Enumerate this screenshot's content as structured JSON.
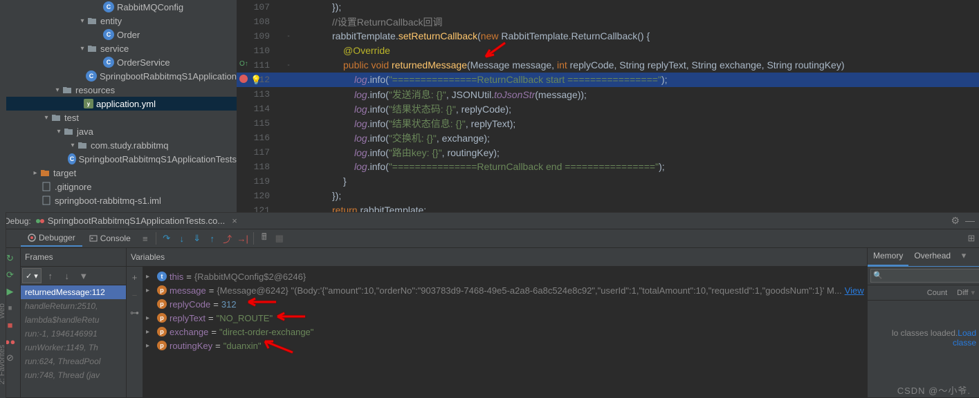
{
  "project": {
    "items": [
      {
        "label": "RabbitMQConfig",
        "indent": 128,
        "icon": "class",
        "arrow": ""
      },
      {
        "label": "entity",
        "indent": 104,
        "icon": "folder",
        "arrow": "▾"
      },
      {
        "label": "Order",
        "indent": 128,
        "icon": "class",
        "arrow": ""
      },
      {
        "label": "service",
        "indent": 104,
        "icon": "folder",
        "arrow": "▾"
      },
      {
        "label": "OrderService",
        "indent": 128,
        "icon": "class",
        "arrow": ""
      },
      {
        "label": "SpringbootRabbitmqS1Application",
        "indent": 104,
        "icon": "class-run",
        "arrow": ""
      },
      {
        "label": "resources",
        "indent": 68,
        "icon": "res-folder",
        "arrow": "▾"
      },
      {
        "label": "application.yml",
        "indent": 100,
        "icon": "yml",
        "arrow": "",
        "selected": true
      },
      {
        "label": "test",
        "indent": 52,
        "icon": "folder",
        "arrow": "▾"
      },
      {
        "label": "java",
        "indent": 70,
        "icon": "folder",
        "arrow": "▾"
      },
      {
        "label": "com.study.rabbitmq",
        "indent": 90,
        "icon": "folder",
        "arrow": "▾"
      },
      {
        "label": "SpringbootRabbitmqS1ApplicationTests",
        "indent": 114,
        "icon": "class-run",
        "arrow": ""
      },
      {
        "label": "target",
        "indent": 36,
        "icon": "target",
        "arrow": "▸"
      },
      {
        "label": ".gitignore",
        "indent": 38,
        "icon": "file",
        "arrow": ""
      },
      {
        "label": "springboot-rabbitmq-s1.iml",
        "indent": 38,
        "icon": "file",
        "arrow": ""
      }
    ]
  },
  "editor": {
    "lines": [
      {
        "no": 107,
        "segments": [
          {
            "ind": 36
          },
          {
            "t": "});",
            "k": "pl"
          }
        ]
      },
      {
        "no": 108,
        "segments": [
          {
            "ind": 36
          },
          {
            "t": "//设置ReturnCallback回调",
            "k": "cm"
          }
        ]
      },
      {
        "no": 109,
        "fold": "-",
        "segments": [
          {
            "ind": 36
          },
          {
            "t": "rabbitTemplate.",
            "k": "pl"
          },
          {
            "t": "setReturnCallback",
            "k": "fn"
          },
          {
            "t": "(",
            "k": "pl"
          },
          {
            "t": "new ",
            "k": "kw"
          },
          {
            "t": "RabbitTemplate.ReturnCallback() {",
            "k": "pl"
          }
        ]
      },
      {
        "no": 110,
        "segments": [
          {
            "ind": 52
          },
          {
            "t": "@Override",
            "k": "an"
          }
        ]
      },
      {
        "no": 111,
        "gutter": "override",
        "fold": "-",
        "segments": [
          {
            "ind": 52
          },
          {
            "t": "public void ",
            "k": "kw"
          },
          {
            "t": "returnedMessage",
            "k": "fn"
          },
          {
            "t": "(Message message, ",
            "k": "pl"
          },
          {
            "t": "int ",
            "k": "kw"
          },
          {
            "t": "replyCode, String replyText, String exchange, String routingKey)",
            "k": "pl"
          }
        ]
      },
      {
        "no": 112,
        "bp": true,
        "hl": true,
        "segments": [
          {
            "ind": 68
          },
          {
            "t": "log",
            "k": "vr"
          },
          {
            "t": ".info(",
            "k": "plh"
          },
          {
            "t": "\"===============ReturnCallback start ================\"",
            "k": "strH"
          },
          {
            "t": ");",
            "k": "plh"
          }
        ]
      },
      {
        "no": 113,
        "segments": [
          {
            "ind": 68
          },
          {
            "t": "log",
            "k": "vr"
          },
          {
            "t": ".info(",
            "k": "pl"
          },
          {
            "t": "\"发送消息: {}\"",
            "k": "str"
          },
          {
            "t": ", JSONUtil.",
            "k": "pl"
          },
          {
            "t": "toJsonStr",
            "k": "vr"
          },
          {
            "t": "(message));",
            "k": "pl"
          }
        ]
      },
      {
        "no": 114,
        "segments": [
          {
            "ind": 68
          },
          {
            "t": "log",
            "k": "vr"
          },
          {
            "t": ".info(",
            "k": "pl"
          },
          {
            "t": "\"结果状态码: {}\"",
            "k": "str"
          },
          {
            "t": ", replyCode);",
            "k": "pl"
          }
        ]
      },
      {
        "no": 115,
        "segments": [
          {
            "ind": 68
          },
          {
            "t": "log",
            "k": "vr"
          },
          {
            "t": ".info(",
            "k": "pl"
          },
          {
            "t": "\"结果状态信息: {}\"",
            "k": "str"
          },
          {
            "t": ", replyText);",
            "k": "pl"
          }
        ]
      },
      {
        "no": 116,
        "segments": [
          {
            "ind": 68
          },
          {
            "t": "log",
            "k": "vr"
          },
          {
            "t": ".info(",
            "k": "pl"
          },
          {
            "t": "\"交换机: {}\"",
            "k": "str"
          },
          {
            "t": ", exchange);",
            "k": "pl"
          }
        ]
      },
      {
        "no": 117,
        "segments": [
          {
            "ind": 68
          },
          {
            "t": "log",
            "k": "vr"
          },
          {
            "t": ".info(",
            "k": "pl"
          },
          {
            "t": "\"路由key: {}\"",
            "k": "str"
          },
          {
            "t": ", routingKey);",
            "k": "pl"
          }
        ]
      },
      {
        "no": 118,
        "segments": [
          {
            "ind": 68
          },
          {
            "t": "log",
            "k": "vr"
          },
          {
            "t": ".info(",
            "k": "pl"
          },
          {
            "t": "\"===============ReturnCallback end ================\"",
            "k": "str"
          },
          {
            "t": ");",
            "k": "pl"
          }
        ]
      },
      {
        "no": 119,
        "segments": [
          {
            "ind": 52
          },
          {
            "t": "}",
            "k": "pl"
          }
        ]
      },
      {
        "no": 120,
        "segments": [
          {
            "ind": 36
          },
          {
            "t": "});",
            "k": "pl"
          }
        ]
      },
      {
        "no": 121,
        "segments": [
          {
            "ind": 36
          },
          {
            "t": "return ",
            "k": "kw"
          },
          {
            "t": "rabbitTemplate;",
            "k": "pl"
          }
        ]
      }
    ]
  },
  "debug": {
    "title": "Debug:",
    "runConfig": "SpringbootRabbitmqS1ApplicationTests.co...",
    "debuggerTab": "Debugger",
    "consoleTab": "Console",
    "framesTitle": "Frames",
    "variablesTitle": "Variables",
    "frames": [
      {
        "label": "returnedMessage:112",
        "active": true
      },
      {
        "label": "handleReturn:2510, ",
        "active": false
      },
      {
        "label": "lambda$handleRetu",
        "active": false
      },
      {
        "label": "run:-1, 1946146991",
        "active": false
      },
      {
        "label": "runWorker:1149, Th",
        "active": false
      },
      {
        "label": "run:624, ThreadPool",
        "active": false
      },
      {
        "label": "run:748, Thread (jav",
        "active": false
      }
    ],
    "vars": [
      {
        "badge": "this",
        "name": "this",
        "val": "{RabbitMQConfig$2@6246}",
        "type": "obj",
        "arrow": "▸"
      },
      {
        "badge": "param",
        "name": "message",
        "val": "{Message@6242} \"(Body:'{\"amount\":10,\"orderNo\":\"903783d9-7468-49e5-a2a8-6a8c524e8c92\",\"userId\":1,\"totalAmount\":10,\"requestId\":1,\"goodsNum\":1}' M...",
        "type": "obj",
        "arrow": "▸",
        "view": "View"
      },
      {
        "badge": "param",
        "name": "replyCode",
        "val": "312",
        "type": "num",
        "arrow": ""
      },
      {
        "badge": "param",
        "name": "replyText",
        "val": "\"NO_ROUTE\"",
        "type": "str",
        "arrow": "▸"
      },
      {
        "badge": "param",
        "name": "exchange",
        "val": "\"direct-order-exchange\"",
        "type": "str",
        "arrow": "▸"
      },
      {
        "badge": "param",
        "name": "routingKey",
        "val": "\"duanxin\"",
        "type": "str",
        "arrow": "▸"
      }
    ],
    "memory": {
      "tab1": "Memory",
      "tab2": "Overhead",
      "searchPlaceholder": "",
      "colCount": "Count",
      "colDiff": "Diff",
      "emptyText": "lo classes loaded.",
      "loadLink": "Load classe"
    }
  },
  "sideTabs": {
    "favorites": "2: Favorites",
    "web": "Web"
  },
  "watermark": "CSDN @～小爷."
}
